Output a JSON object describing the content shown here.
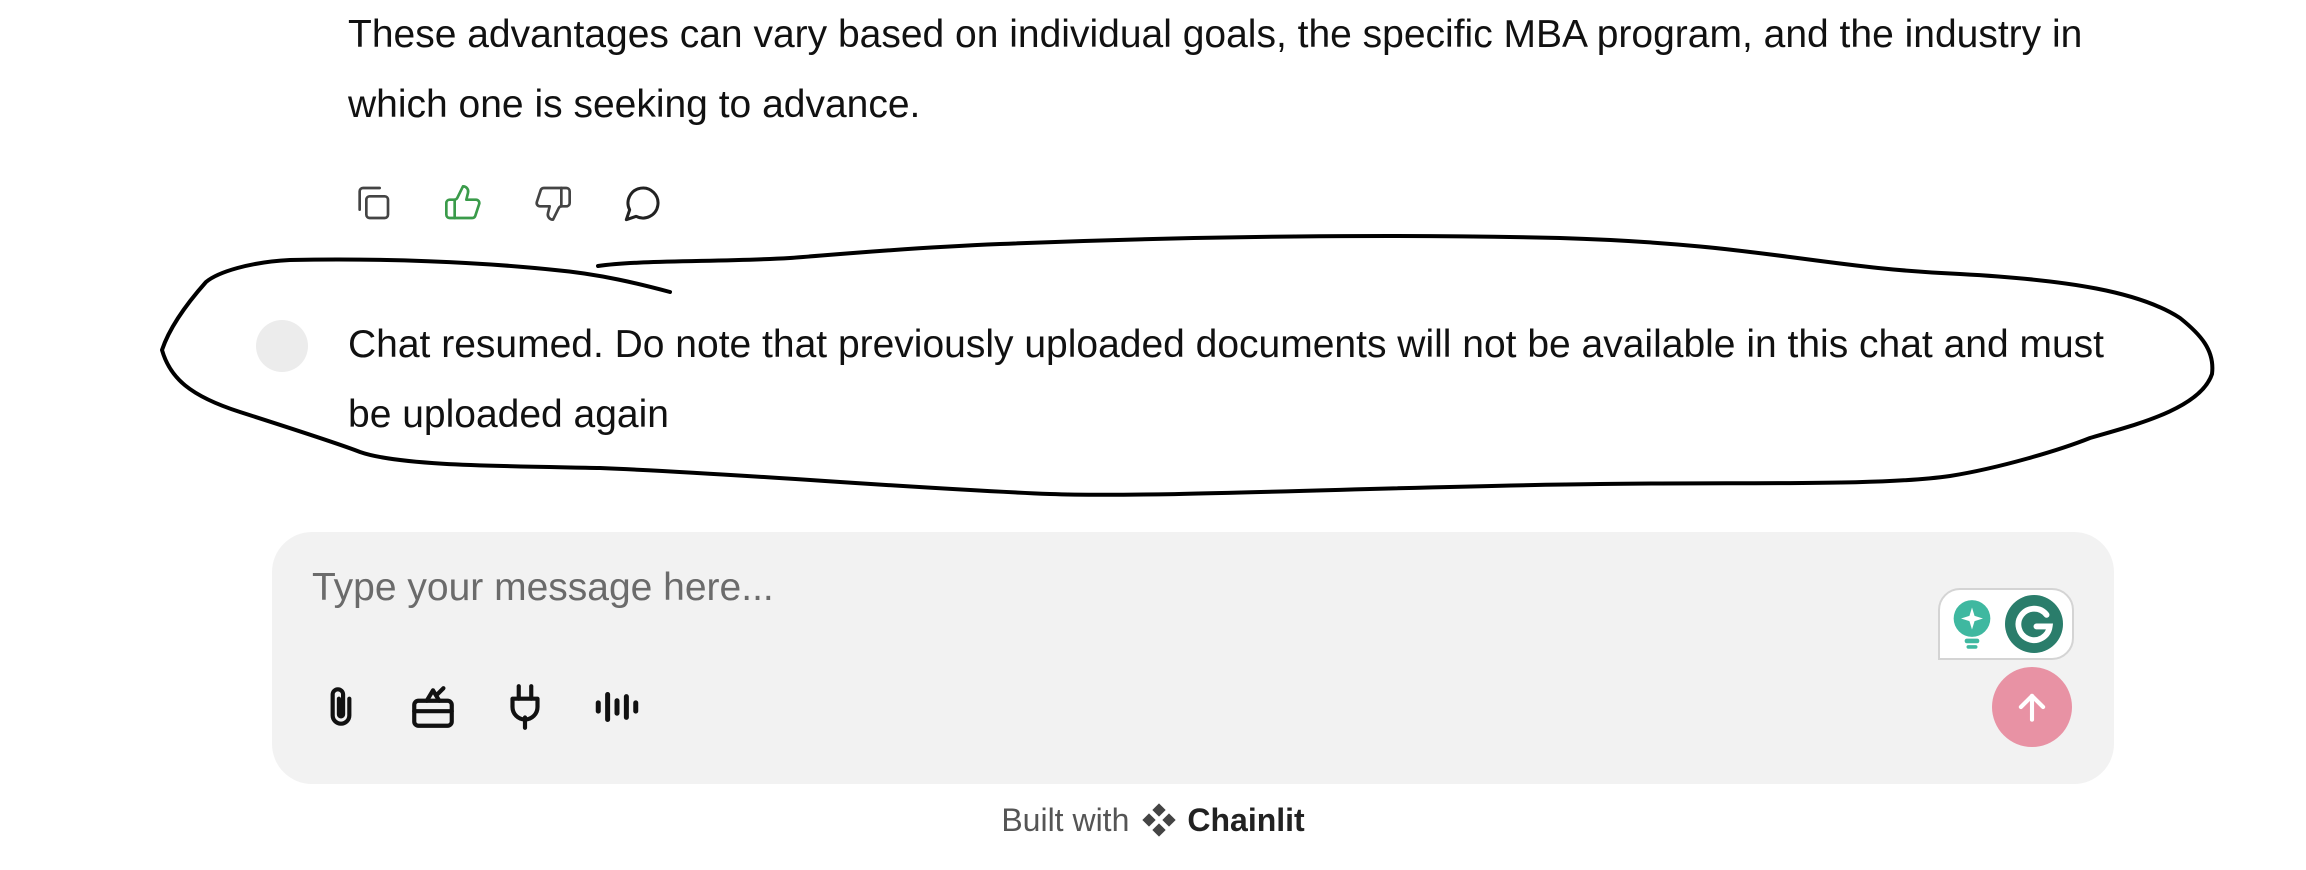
{
  "messages": {
    "previous_text": "These advantages can vary based on individual goals, the specific MBA program, and the industry in which one is seeking to advance.",
    "resume_text": "Chat resumed. Do note that previously uploaded documents will not be available in this chat and must be uploaded again"
  },
  "actions": [
    {
      "icon": "copy-icon"
    },
    {
      "icon": "thumbs-up-icon",
      "color": "#3a9b4a"
    },
    {
      "icon": "thumbs-down-icon"
    },
    {
      "icon": "comment-icon"
    }
  ],
  "composer": {
    "placeholder": "Type your message here...",
    "tools": [
      "paperclip-icon",
      "tasks-icon",
      "plug-icon",
      "audio-waveform-icon"
    ],
    "send_color": "#e892a4"
  },
  "footer": {
    "built_with": "Built with",
    "brand": "Chainlit"
  },
  "colors": {
    "composer_bg": "#f2f2f2",
    "grammarly_green": "#2a7d6b",
    "bulb_teal": "#3fb8a0"
  }
}
